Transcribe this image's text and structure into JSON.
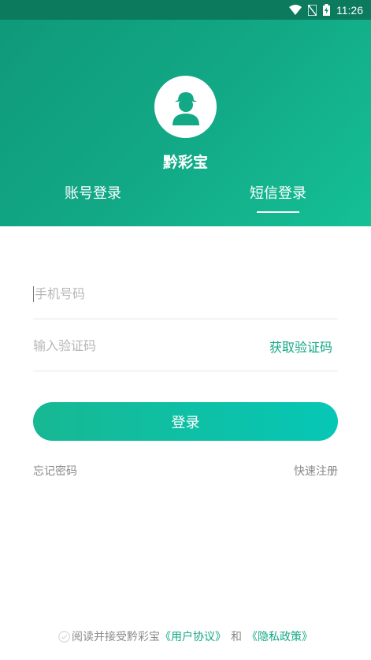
{
  "status_bar": {
    "time": "11:26",
    "icons": [
      "wifi-icon",
      "no-sim-icon",
      "battery-charging-icon"
    ]
  },
  "header": {
    "avatar_icon": "user-avatar-icon",
    "app_name": "黔彩宝",
    "tabs": [
      {
        "label": "账号登录",
        "active": false
      },
      {
        "label": "短信登录",
        "active": true
      }
    ]
  },
  "form": {
    "phone": {
      "placeholder": "手机号码",
      "value": ""
    },
    "code": {
      "placeholder": "输入验证码",
      "value": ""
    },
    "get_code_label": "获取验证码",
    "login_label": "登录",
    "forgot_label": "忘记密码",
    "register_label": "快速注册"
  },
  "agreement": {
    "checked": false,
    "prefix": "阅读并接受黔彩宝",
    "user_agreement": "《用户协议》",
    "conjunction": "和",
    "privacy_policy": "《隐私政策》"
  },
  "colors": {
    "brand": "#13a886",
    "header_start": "#0f9a7a",
    "header_end": "#15c095",
    "button_start": "#17b892",
    "button_end": "#06c7b6",
    "muted_text": "#8a8a8a"
  }
}
